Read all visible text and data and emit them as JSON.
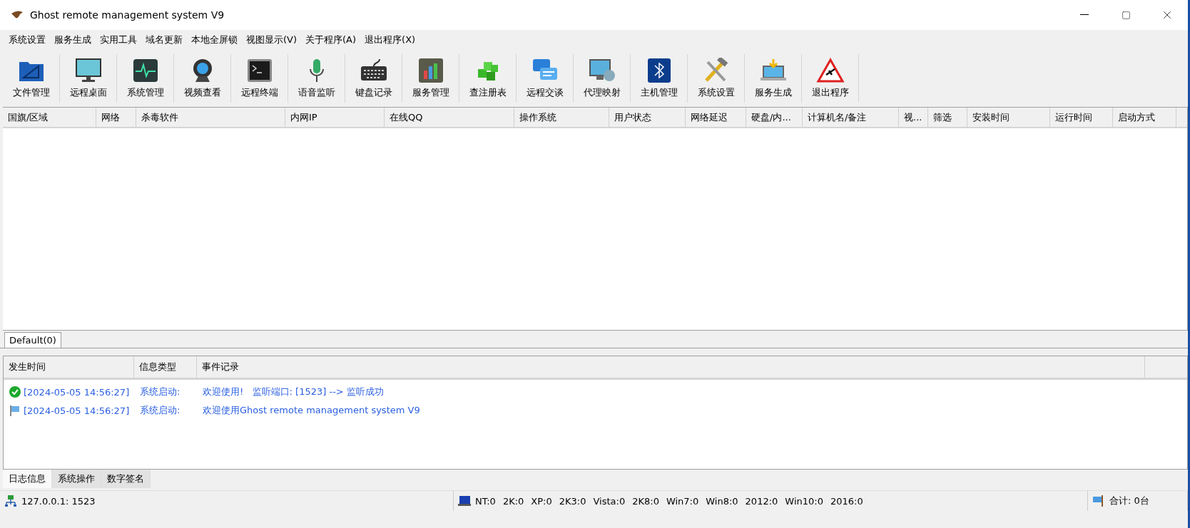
{
  "window": {
    "title": "Ghost remote management system V9"
  },
  "menu": [
    "系统设置",
    "服务生成",
    "实用工具",
    "域名更新",
    "本地全屏锁",
    "视图显示(V)",
    "关于程序(A)",
    "退出程序(X)"
  ],
  "toolbar": [
    {
      "label": "文件管理",
      "kind": "folder"
    },
    {
      "label": "远程桌面",
      "kind": "monitor"
    },
    {
      "label": "系统管理",
      "kind": "activity"
    },
    {
      "label": "视频查看",
      "kind": "webcam"
    },
    {
      "label": "远程终端",
      "kind": "terminal"
    },
    {
      "label": "语音监听",
      "kind": "mic"
    },
    {
      "label": "键盘记录",
      "kind": "keyboard"
    },
    {
      "label": "服务管理",
      "kind": "chart"
    },
    {
      "label": "查注册表",
      "kind": "blocks"
    },
    {
      "label": "远程交谈",
      "kind": "chat"
    },
    {
      "label": "代理映射",
      "kind": "globe"
    },
    {
      "label": "主机管理",
      "kind": "bluetooth"
    },
    {
      "label": "系统设置",
      "kind": "tools"
    },
    {
      "label": "服务生成",
      "kind": "laptop"
    },
    {
      "label": "退出程序",
      "kind": "warning"
    }
  ],
  "table": {
    "columns": [
      "国旗/区域",
      "网络",
      "杀毒软件",
      "内网IP",
      "在线QQ",
      "操作系统",
      "用户状态",
      "网络延迟",
      "硬盘/内...",
      "计算机名/备注",
      "视...",
      "筛选",
      "安装时间",
      "运行时间",
      "启动方式"
    ]
  },
  "group_tabs": [
    {
      "label": "Default(0)",
      "selected": true
    }
  ],
  "log": {
    "columns": [
      "发生时间",
      "信息类型",
      "事件记录"
    ],
    "rows": [
      {
        "kind": "success",
        "time": "[2024-05-05 14:56:27]",
        "type": "系统启动:",
        "message": "欢迎使用!   监听端口: [1523] --> 监听成功"
      },
      {
        "kind": "flag",
        "time": "[2024-05-05 14:56:27]",
        "type": "系统启动:",
        "message": "欢迎使用Ghost remote management system V9"
      }
    ]
  },
  "bottom_tabs": [
    {
      "label": "日志信息",
      "selected": true
    },
    {
      "label": "系统操作",
      "selected": false
    },
    {
      "label": "数字签名",
      "selected": false
    }
  ],
  "status_bar": {
    "address": "127.0.0.1: 1523",
    "counts": [
      "NT:0",
      "2K:0",
      "XP:0",
      "2K3:0",
      "Vista:0",
      "2K8:0",
      "Win7:0",
      "Win8:0",
      "2012:0",
      "Win10:0",
      "2016:0"
    ],
    "total": "合计: 0台"
  }
}
